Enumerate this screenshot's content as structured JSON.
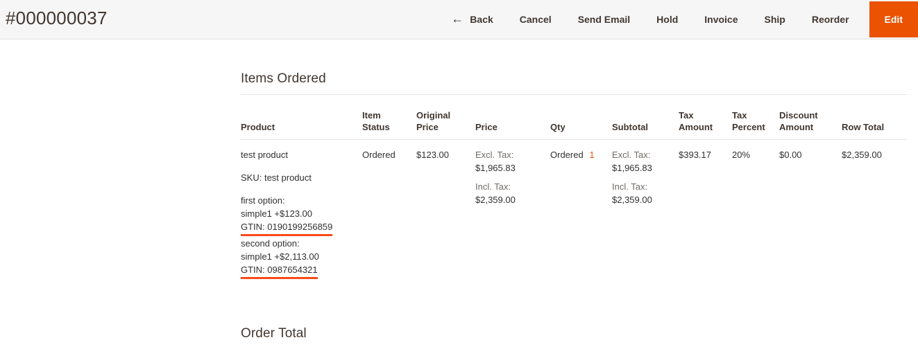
{
  "header": {
    "title": "#000000037",
    "actions": [
      {
        "label": "Back",
        "icon": "arrow-left-icon",
        "primary": false
      },
      {
        "label": "Cancel",
        "icon": null,
        "primary": false
      },
      {
        "label": "Send Email",
        "icon": null,
        "primary": false
      },
      {
        "label": "Hold",
        "icon": null,
        "primary": false
      },
      {
        "label": "Invoice",
        "icon": null,
        "primary": false
      },
      {
        "label": "Ship",
        "icon": null,
        "primary": false
      },
      {
        "label": "Reorder",
        "icon": null,
        "primary": false
      },
      {
        "label": "Edit",
        "icon": null,
        "primary": true
      }
    ],
    "background_color": "#f6f6f6",
    "primary_color": "#eb5202"
  },
  "items_section": {
    "title": "Items Ordered",
    "columns": [
      "Product",
      "Item Status",
      "Original Price",
      "Price",
      "Qty",
      "Subtotal",
      "Tax Amount",
      "Tax Percent",
      "Discount Amount",
      "Row Total"
    ],
    "rows": [
      {
        "product": {
          "name": "test product",
          "sku": "SKU: test product",
          "options": [
            {
              "label": "first option:",
              "value": "simple1 +$123.00",
              "gtin": "GTIN: 0190199256859",
              "gtin_underline_color": "#fc4a18"
            },
            {
              "label": "second option:",
              "value": "simple1 +$2,113.00",
              "gtin": "GTIN: 0987654321",
              "gtin_underline_color": "#fc4a18"
            }
          ]
        },
        "item_status": "Ordered",
        "original_price": "$123.00",
        "price": {
          "excl_tax_label": "Excl. Tax:",
          "excl_tax_value": "$1,965.83",
          "incl_tax_label": "Incl. Tax:",
          "incl_tax_value": "$2,359.00"
        },
        "qty": {
          "label": "Ordered",
          "value": "1",
          "value_color": "#eb5202"
        },
        "subtotal": {
          "excl_tax_label": "Excl. Tax:",
          "excl_tax_value": "$1,965.83",
          "incl_tax_label": "Incl. Tax:",
          "incl_tax_value": "$2,359.00"
        },
        "tax_amount": "$393.17",
        "tax_percent": "20%",
        "discount_amount": "$0.00",
        "row_total": "$2,359.00"
      }
    ]
  },
  "order_total_section": {
    "title": "Order Total"
  }
}
